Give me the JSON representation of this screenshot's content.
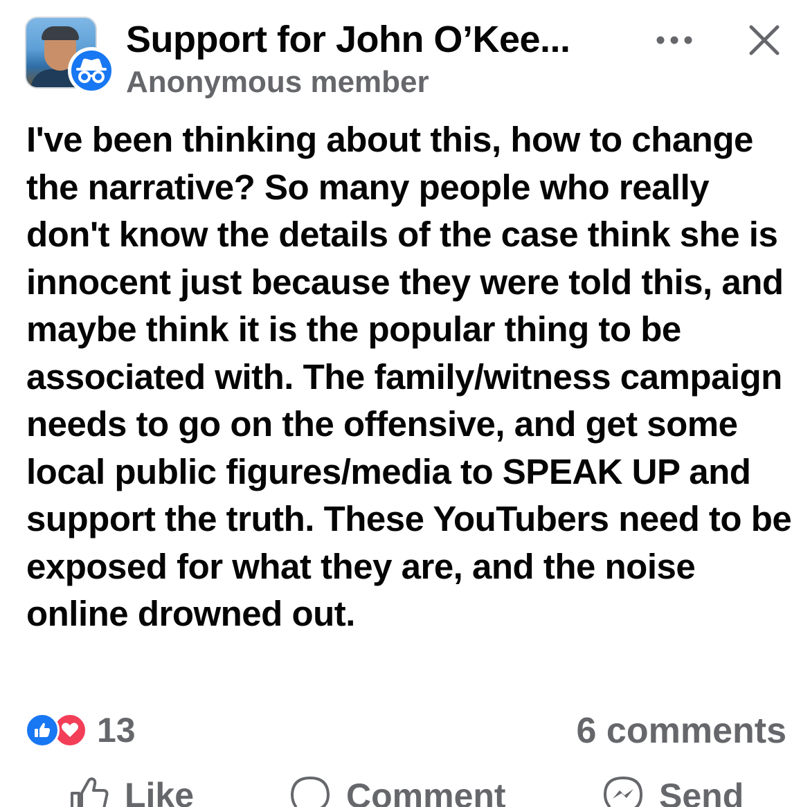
{
  "header": {
    "group_name": "Support for John O’Kee...",
    "member_label": "Anonymous member",
    "avatar_icon": "profile-photo",
    "badge_icon": "anonymous-incognito-icon",
    "more_icon": "more-horizontal-icon",
    "close_icon": "close-icon"
  },
  "post": {
    "text": "I've been thinking about this, how to change the narrative? So many people who really don't know the details of the case think she is innocent just because they were told this, and maybe think it is the popular thing to be associated with. The family/witness campaign needs to go on the offensive, and get some local public figures/media to SPEAK UP and support the truth. These YouTubers need to be exposed for what they are, and the noise online drowned out."
  },
  "stats": {
    "reaction_count": "13",
    "comments_count": "6 comments",
    "reaction_icons": [
      "like-reaction-icon",
      "love-reaction-icon"
    ]
  },
  "actions": {
    "like_label": "Like",
    "comment_label": "Comment",
    "send_label": "Send"
  },
  "colors": {
    "accent": "#1877f2",
    "love": "#f33e58",
    "secondary_text": "#65676b",
    "primary_text": "#050505"
  }
}
